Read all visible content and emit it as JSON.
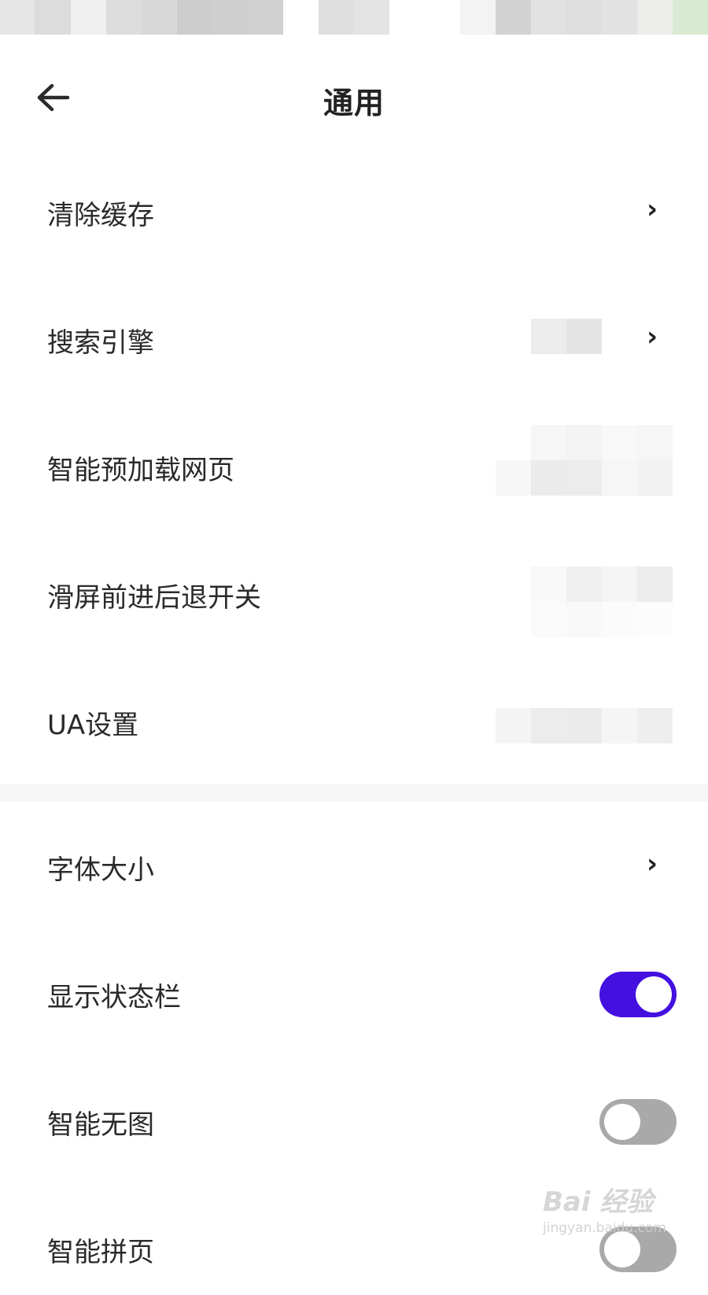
{
  "header": {
    "title": "通用",
    "back_icon": "back-arrow-icon"
  },
  "settings": [
    {
      "label": "清除缓存",
      "control": "chevron"
    },
    {
      "label": "搜索引擎",
      "control": "chevron"
    },
    {
      "label": "智能预加载网页",
      "control": "none"
    },
    {
      "label": "滑屏前进后退开关",
      "control": "none"
    },
    {
      "label": "UA设置",
      "control": "none"
    },
    {
      "label": "字体大小",
      "control": "chevron"
    },
    {
      "label": "显示状态栏",
      "control": "toggle",
      "enabled": true
    },
    {
      "label": "智能无图",
      "control": "toggle",
      "enabled": false
    },
    {
      "label": "智能拼页",
      "control": "toggle",
      "enabled": false
    }
  ],
  "colors": {
    "toggle_on": "#4410e0",
    "toggle_off": "#a9a9a9",
    "divider": "#f6f6f6"
  },
  "watermark": {
    "brand": "Bai 经验",
    "url": "jingyan.baidu.com"
  }
}
